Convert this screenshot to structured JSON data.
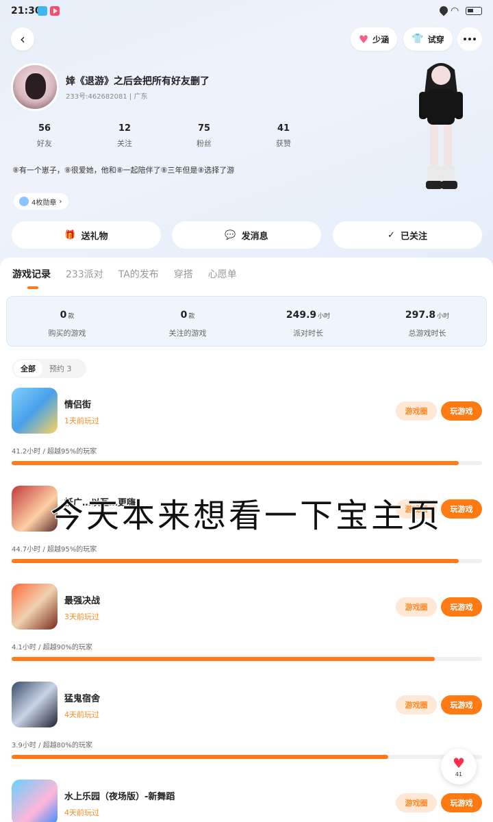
{
  "status_bar": {
    "time": "21:30"
  },
  "top_nav": {
    "partner_label": "少涵",
    "tryon_label": "试穿"
  },
  "profile": {
    "username": "婞《退游》之后会把所有好友删了",
    "user_id": "233号:462682081",
    "location": "广东",
    "stats": [
      {
        "value": "56",
        "label": "好友"
      },
      {
        "value": "12",
        "label": "关注"
      },
      {
        "value": "75",
        "label": "粉丝"
      },
      {
        "value": "41",
        "label": "获赞"
      }
    ],
    "bio": "⑧有一个崽子，⑧很爱她，他和⑧一起陪伴了⑧三年但是⑧选择了游",
    "badges_label": "4枚勋章"
  },
  "actions": {
    "gift": "送礼物",
    "message": "发消息",
    "followed": "已关注"
  },
  "tabs": [
    "游戏记录",
    "233派对",
    "TA的发布",
    "穿搭",
    "心愿单"
  ],
  "summary": [
    {
      "value": "0",
      "unit": "款",
      "label": "购买的游戏"
    },
    {
      "value": "0",
      "unit": "款",
      "label": "关注的游戏"
    },
    {
      "value": "249.9",
      "unit": "小时",
      "label": "派对时长"
    },
    {
      "value": "297.8",
      "unit": "小时",
      "label": "总游戏时长"
    }
  ],
  "filters": {
    "all": "全部",
    "reserved": "预约 3"
  },
  "games": [
    {
      "name": "情侣街",
      "last_played": "1天前玩过",
      "stat": "41.2小时 / 超越95%的玩家",
      "percent": 95
    },
    {
      "name": "抵广…以互…更嗨",
      "last_played": "",
      "stat": "44.7小时 / 超越95%的玩家",
      "percent": 95
    },
    {
      "name": "最强决战",
      "last_played": "3天前玩过",
      "stat": "4.1小时 / 超越90%的玩家",
      "percent": 90
    },
    {
      "name": "猛鬼宿舍",
      "last_played": "4天前玩过",
      "stat": "3.9小时 / 超越80%的玩家",
      "percent": 80
    },
    {
      "name": "水上乐园（夜场版）-新舞蹈",
      "last_played": "4天前玩过",
      "stat": "",
      "percent": 0
    }
  ],
  "game_buttons": {
    "circle": "游戏圈",
    "play": "玩游戏"
  },
  "overlay_caption": "今天本来想看一下宝主页",
  "like_count": "41",
  "colors": {
    "accent": "#ff7a1a",
    "header_bg": "#e6eef8"
  }
}
